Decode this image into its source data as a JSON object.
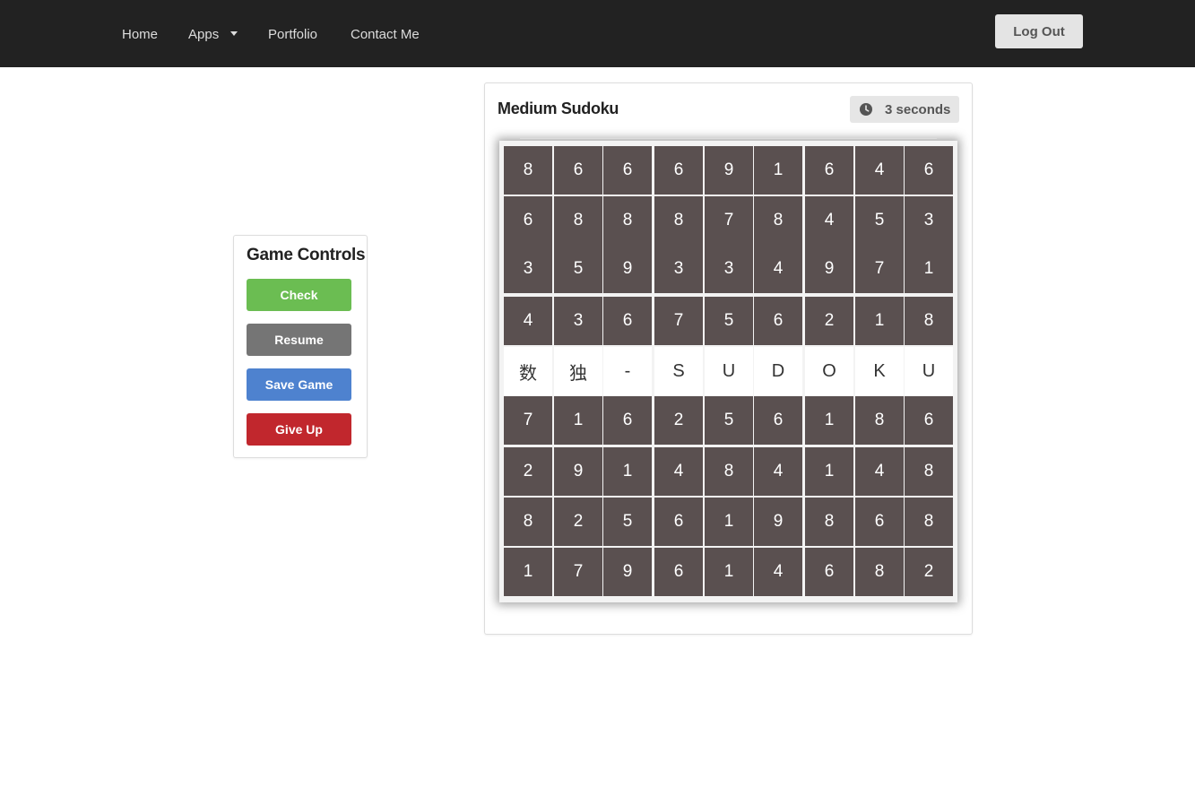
{
  "nav": {
    "items": [
      {
        "label": "Home"
      },
      {
        "label": "Apps",
        "has_dropdown": true
      },
      {
        "label": "Portfolio"
      },
      {
        "label": "Contact Me"
      }
    ],
    "logout_label": "Log Out"
  },
  "controls": {
    "title": "Game Controls",
    "buttons": [
      {
        "label": "Check",
        "color": "#6bbd52"
      },
      {
        "label": "Resume",
        "color": "#757575"
      },
      {
        "label": "Save Game",
        "color": "#4e82cf"
      },
      {
        "label": "Give Up",
        "color": "#c1272d"
      }
    ]
  },
  "game": {
    "title": "Medium Sudoku",
    "timer_icon": "clock-icon",
    "timer_text": "3 seconds",
    "cell_color": "#5a5050",
    "light_cell_color": "#ffffff",
    "grid": [
      [
        "8",
        "6",
        "6",
        "6",
        "9",
        "1",
        "6",
        "4",
        "6"
      ],
      [
        "6",
        "8",
        "8",
        "8",
        "7",
        "8",
        "4",
        "5",
        "3"
      ],
      [
        "3",
        "5",
        "9",
        "3",
        "3",
        "4",
        "9",
        "7",
        "1"
      ],
      [
        "4",
        "3",
        "6",
        "7",
        "5",
        "6",
        "2",
        "1",
        "8"
      ],
      [
        "数",
        "独",
        "-",
        "S",
        "U",
        "D",
        "O",
        "K",
        "U"
      ],
      [
        "7",
        "1",
        "6",
        "2",
        "5",
        "6",
        "1",
        "8",
        "6"
      ],
      [
        "2",
        "9",
        "1",
        "4",
        "8",
        "4",
        "1",
        "4",
        "8"
      ],
      [
        "8",
        "2",
        "5",
        "6",
        "1",
        "9",
        "8",
        "6",
        "8"
      ],
      [
        "1",
        "7",
        "9",
        "6",
        "1",
        "4",
        "6",
        "8",
        "2"
      ]
    ],
    "light_row": 4
  }
}
